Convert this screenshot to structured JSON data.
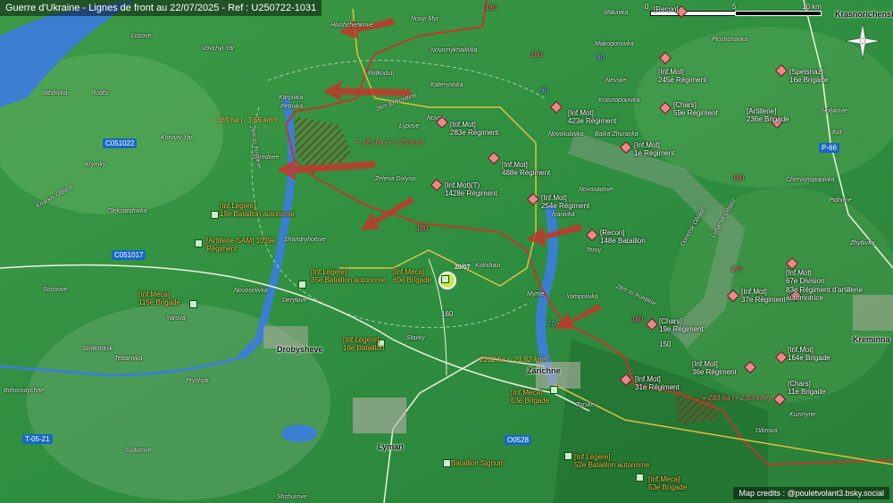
{
  "title": "Guerre d'Ukraine - Lignes de front au 22/07/2025 - Ref : U250722-1031",
  "credits": "Map credits : @pouletvolant3.bsky.social",
  "scale": {
    "zero": "0",
    "mid": "5",
    "end": "10 km"
  },
  "roads": {
    "c051022": "C051022",
    "c051017": "C051017",
    "t0521": "T-05-21",
    "o0528": "O0528",
    "p66": "P-66"
  },
  "route_numbers": {
    "r180a": "180",
    "r180b": "180",
    "r180c": "180",
    "r180d": "180",
    "r170": "170",
    "r160a": "160",
    "r160b": "160",
    "r150": "150",
    "r90": "90",
    "r80": "80",
    "r70": "70"
  },
  "towns": {
    "drobysheve": "Drobysheve",
    "lyman": "Lyman",
    "zarichne": "Zarichne",
    "kreminna": "Kreminna",
    "krasnorichenske": "Krasnorichenske"
  },
  "villages": {
    "hlushchenkove": "Hlushchenkove",
    "novyi_myr": "Novyi Myr",
    "novomykhailivka": "Novomykhailivka",
    "ridkodub": "Ridkodub",
    "katerynivka": "Katerynivka",
    "karpivka": "Karpivka",
    "petrivka": "Petrivka",
    "novoe": "Novoe",
    "lypove": "Lypove",
    "seredne": "Serednee",
    "zelena_dolyna": "Zelena Dolyna",
    "shandryholove": "Shandryholove",
    "koroviy_yar": "Koroviy Yar",
    "kolodiazi": "Kolodiazi",
    "novoselivka": "Novoselivka",
    "derylove": "Derylove",
    "yarova": "Yarova",
    "stavky": "Stavky",
    "myrne": "Myrne",
    "yampolivka": "Yampolivka",
    "terny": "Terny",
    "ivanivka": "Ivanivka",
    "novosadove": "Novosadove",
    "makiivka": "Makiivka",
    "nevske": "Nevske",
    "krasnopopivka": "Krasnopopivka",
    "novoliubivka": "Novoliubivka",
    "balka_zhuravka": "Balka Zhuravka",
    "makogonovka": "Makogonovka",
    "ploshchanka": "Ploshchanka",
    "chervonopopivka": "Chervonopopivka",
    "pidhirne": "Pidhirne",
    "zhytlivka": "Zhytlivka",
    "holykove": "Holykove",
    "kuzmyne": "Kuzmyne",
    "dibrova": "Dibrova",
    "torske": "Torske",
    "pryshyb": "Pryshyb",
    "sviatohirsk": "Sviatohirsk",
    "tetianivka": "Tetianivka",
    "bohorodychne": "Bohorodychne",
    "sydorove": "Sydorove",
    "sosnove": "Sosnove",
    "oleksandrivka": "Oleksandrivka",
    "krymky": "Krymky",
    "rubtsi": "Rubtsi",
    "yatskivka": "Yatskivka",
    "lozove": "Lozove",
    "vovchyi_yar": "Vovchyi Yar",
    "shchurove": "Shchurove",
    "kut": "Kut",
    "kharkiv_oblast": "Kharkiv Oblast",
    "donetsk_oblast": "Donetsk Oblast",
    "luhansk_oblast": "Luhansk Oblast"
  },
  "front_labels": {
    "f2km_a": "2km to frontline",
    "f2km_b": "2km to frontline",
    "f2km_c": "2km to frontline"
  },
  "ru_units": [
    {
      "key": "recon_top",
      "text": "[Recon]"
    },
    {
      "key": "infmot_245",
      "text": "[Inf.Mot]\n245e Régiment"
    },
    {
      "key": "spetsnaz_16",
      "text": "[Spetsnaz]\n16e Brigade"
    },
    {
      "key": "infmot_423",
      "text": "[Inf.Mot]\n423e Régiment"
    },
    {
      "key": "chars_59",
      "text": "[Chars]\n59e Régiment"
    },
    {
      "key": "artillerie_236",
      "text": "[Artillerie]\n236e Brigade"
    },
    {
      "key": "infmot_283",
      "text": "[Inf.Mot]\n283e Régiment"
    },
    {
      "key": "infmot_1",
      "text": "[Inf.Mot]\n1e Régiment"
    },
    {
      "key": "infmot_488",
      "text": "[Inf.Mot]\n488e Régiment"
    },
    {
      "key": "infmot_1428",
      "text": "[Inf.Mot](T)\n1428e Régiment"
    },
    {
      "key": "infmot_254",
      "text": "[Inf.Mot]\n254e Régiment"
    },
    {
      "key": "recon_148",
      "text": "[Recon]\n148e Bataillon"
    },
    {
      "key": "infmot_67",
      "text": "[Inf.Mot]\n67e Division"
    },
    {
      "key": "infmot_37",
      "text": "[Inf.Mot]\n37e Régiment"
    },
    {
      "key": "reg_83",
      "text": "83e Régiment d'artillerie\nautomotrice"
    },
    {
      "key": "chars_19",
      "text": "[Chars]\n19e Régiment"
    },
    {
      "key": "infmot_164",
      "text": "[Inf.Mot]\n164e Brigade"
    },
    {
      "key": "infmot_36",
      "text": "[Inf.Mot]\n36e Régiment"
    },
    {
      "key": "infmot_31",
      "text": "[Inf.Mot]\n31e Régiment"
    },
    {
      "key": "chars_11",
      "text": "[Chars]\n11e Brigade"
    }
  ],
  "ua_units": [
    {
      "key": "infleg_19",
      "text": "[Inf.Légère]\n19e Bataillon autonome"
    },
    {
      "key": "artsam_1039",
      "text": "[Artillerie-SAM] 1039e\nRégiment"
    },
    {
      "key": "infleg_35",
      "text": "[Inf.Légère]\n35e Bataillon autonome"
    },
    {
      "key": "infmeca_60",
      "text": "[Inf.Meca]\n60e Brigade"
    },
    {
      "key": "infmeca_115",
      "text": "[Inf.Meca]\n115e Brigade"
    },
    {
      "key": "infleg_16",
      "text": "[Inf.Légère]\n16e Bataillon"
    },
    {
      "key": "infmeca_63",
      "text": "[Inf.Meca]\n63e Brigade"
    },
    {
      "key": "bataillon_signum",
      "text": "Bataillon Signum"
    },
    {
      "key": "infleg_52",
      "text": "[Inf.Légère]\n52e Bataillon autonome"
    },
    {
      "key": "infmeca_53",
      "text": "[Inf.Meca]\n53e Brigade"
    }
  ],
  "areas": {
    "loss_365": "- 365 ha (- 3.65 km²)",
    "gain_375": "+ 375 ha (+ 3.75 km²)",
    "loss_2162": "- 2162 ha (- 21.62 km²)",
    "gain_283": "+ 283 ha (+ 2.83 km²)"
  },
  "dates": {
    "d2007": "20/07"
  },
  "colors": {
    "ru_front": "#c0392b",
    "ua_line": "#e0c040",
    "water": "#3a7fd0",
    "terrain": "#2e8b3e"
  }
}
